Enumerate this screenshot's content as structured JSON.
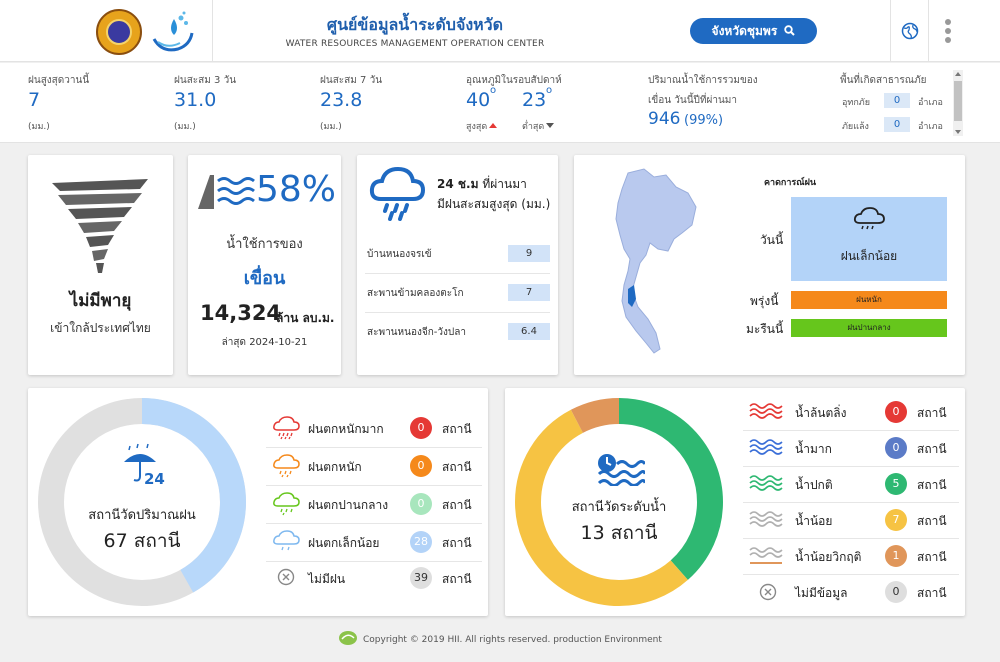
{
  "header": {
    "title": "ศูนย์ข้อมูลน้ำระดับจังหวัด",
    "subtitle": "WATER RESOURCES MANAGEMENT OPERATION CENTER",
    "province_button": "จังหวัดชุมพร"
  },
  "stats": {
    "rain_today": {
      "label": "ฝนสูงสุดวานนี้",
      "value": "7",
      "unit": "(มม.)"
    },
    "rain_3d": {
      "label": "ฝนสะสม 3 วัน",
      "value": "31.0",
      "unit": "(มม.)"
    },
    "rain_7d": {
      "label": "ฝนสะสม 7 วัน",
      "value": "23.8",
      "unit": "(มม.)"
    },
    "temp": {
      "label": "อุณหภูมิในรอบสัปดาห์",
      "max_value": "40",
      "max_label": "สูงสุด",
      "min_value": "23",
      "min_label": "ต่ำสุด",
      "deg": "o"
    },
    "dam": {
      "label1": "ปริมาณน้ำใช้การรวมของ",
      "label2": "เขื่อน วันนี้ปีที่ผ่านมา",
      "value": "946",
      "percent": "(99%)"
    },
    "disaster": {
      "label": "พื้นที่เกิดสาธารณภัย",
      "flood_label": "อุทกภัย",
      "flood_value": "0",
      "drought_label": "ภัยแล้ง",
      "drought_value": "0",
      "unit": "อำเภอ"
    }
  },
  "storm_card": {
    "title": "ไม่มีพายุ",
    "subtitle": "เข้าใกล้ประเทศไทย"
  },
  "dam_card": {
    "percent": "58%",
    "line1": "น้ำใช้การของ",
    "line2": "เขื่อน",
    "amount": "14,324",
    "amount_unit": "ล้าน ลบ.ม.",
    "updated": "ล่าสุด 2024-10-21"
  },
  "rain24_card": {
    "title_bold": "24 ช.ม",
    "title_rest": "ที่ผ่านมา",
    "title2": "มีฝนสะสมสูงสุด (มม.)",
    "rows": [
      {
        "name": "บ้านหนองจรเข้",
        "value": "9"
      },
      {
        "name": "สะพานข้ามคลองตะโก",
        "value": "7"
      },
      {
        "name": "สะพานหนองจีก-วังปลา",
        "value": "6.4"
      }
    ]
  },
  "forecast_card": {
    "title": "คาดการณ์ฝน",
    "today_label": "วันนี้",
    "today_value": "ฝนเล็กน้อย",
    "tomorrow_label": "พรุ่งนี้",
    "tomorrow_value": "ฝนหนัก",
    "after_label": "มะรืนนี้",
    "after_value": "ฝนปานกลาง",
    "colors": {
      "today": "#b3d3f8",
      "tomorrow": "#f5891b",
      "after": "#66c61c"
    }
  },
  "rain_station_card": {
    "center_label": "สถานีวัดปริมาณฝน",
    "center_value": "67 สถานี",
    "unit": "สถานี",
    "legend": [
      {
        "label": "ฝนตกหนักมาก",
        "count": "0",
        "color": "#e53935",
        "icon": "heavy-rain-icon"
      },
      {
        "label": "ฝนตกหนัก",
        "count": "0",
        "color": "#f5891b",
        "icon": "rain-icon"
      },
      {
        "label": "ฝนตกปานกลาง",
        "count": "0",
        "color": "#a8e6bd",
        "icon": "moderate-rain-icon"
      },
      {
        "label": "ฝนตกเล็กน้อย",
        "count": "28",
        "color": "#b3d3f8",
        "icon": "light-rain-icon"
      },
      {
        "label": "ไม่มีฝน",
        "count": "39",
        "color": "#dedede",
        "icon": "no-rain-icon"
      }
    ]
  },
  "water_station_card": {
    "center_label": "สถานีวัดระดับน้ำ",
    "center_value": "13 สถานี",
    "unit": "สถานี",
    "legend": [
      {
        "label": "น้ำล้นตลิ่ง",
        "count": "0",
        "color": "#e53935",
        "icon": "overflow-wave-icon"
      },
      {
        "label": "น้ำมาก",
        "count": "0",
        "color": "#5b7bc7",
        "icon": "high-wave-icon"
      },
      {
        "label": "น้ำปกติ",
        "count": "5",
        "color": "#2eb872",
        "icon": "normal-wave-icon"
      },
      {
        "label": "น้ำน้อย",
        "count": "7",
        "color": "#f6c343",
        "icon": "low-wave-icon"
      },
      {
        "label": "น้ำน้อยวิกฤติ",
        "count": "1",
        "color": "#e0965a",
        "icon": "critical-low-wave-icon"
      },
      {
        "label": "ไม่มีข้อมูล",
        "count": "0",
        "color": "#dedede",
        "icon": "no-data-icon"
      }
    ]
  },
  "footer": {
    "text": "Copyright © 2019 HII. All rights reserved. production Environment"
  }
}
